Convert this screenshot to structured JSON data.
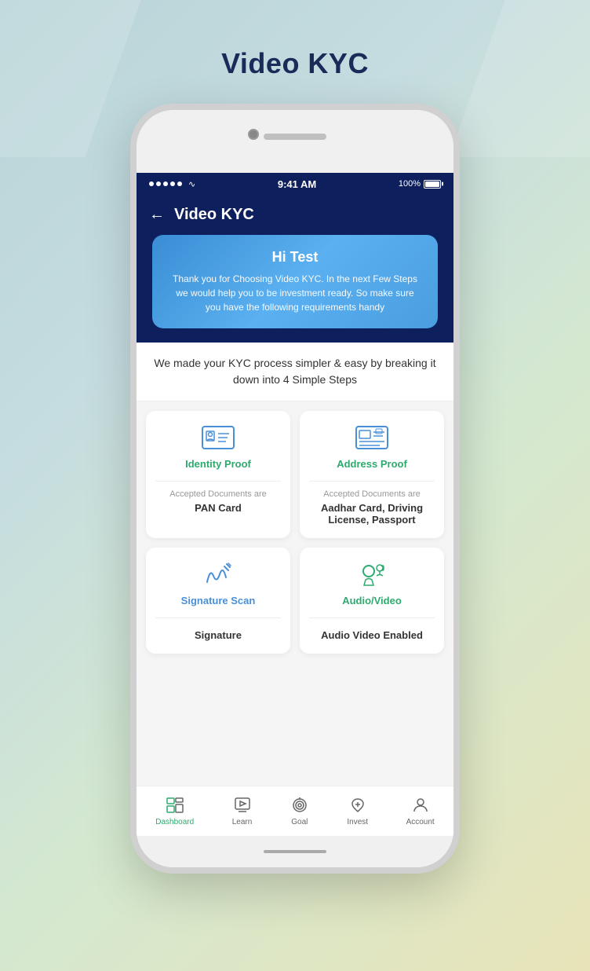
{
  "page": {
    "title": "Video KYC"
  },
  "status_bar": {
    "time": "9:41 AM",
    "battery": "100%",
    "signal_dots": 5
  },
  "header": {
    "title": "Video KYC",
    "back_label": "←"
  },
  "welcome_card": {
    "greeting": "Hi Test",
    "description": "Thank you for Choosing Video KYC. In the next Few Steps we would help you to be investment ready. So make sure you have the following requirements handy"
  },
  "steps_description": "We made your KYC process simpler & easy by breaking it down into 4 Simple Steps",
  "kyc_cards": [
    {
      "id": "identity",
      "title": "Identity Proof",
      "accepted_label": "Accepted Documents are",
      "docs": "PAN Card",
      "icon_type": "identity"
    },
    {
      "id": "address",
      "title": "Address Proof",
      "accepted_label": "Accepted Documents are",
      "docs": "Aadhar Card, Driving License, Passport",
      "icon_type": "address"
    },
    {
      "id": "signature",
      "title": "Signature Scan",
      "accepted_label": "",
      "docs": "Signature",
      "icon_type": "signature"
    },
    {
      "id": "audio",
      "title": "Audio/Video",
      "accepted_label": "",
      "docs": "Audio Video Enabled",
      "icon_type": "audio"
    }
  ],
  "bottom_nav": [
    {
      "id": "dashboard",
      "label": "Dashboard",
      "active": true
    },
    {
      "id": "learn",
      "label": "Learn",
      "active": false
    },
    {
      "id": "goal",
      "label": "Goal",
      "active": false
    },
    {
      "id": "invest",
      "label": "Invest",
      "active": false
    },
    {
      "id": "account",
      "label": "Account",
      "active": false
    }
  ]
}
